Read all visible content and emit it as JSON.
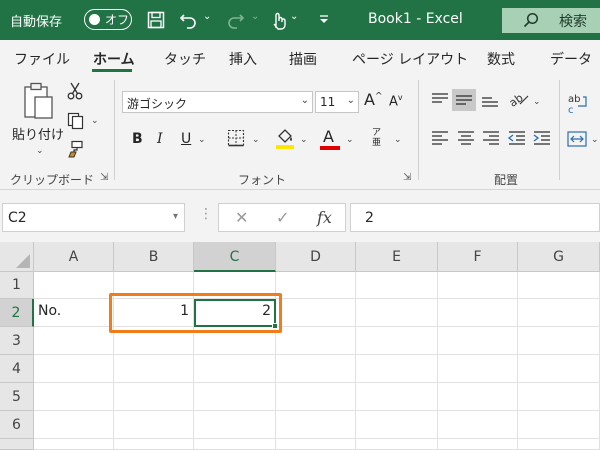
{
  "titlebar": {
    "autosave_label": "自動保存",
    "autosave_state": "オフ",
    "title": "Book1  -  Excel",
    "search_label": "検索"
  },
  "tabs": [
    "ファイル",
    "ホーム",
    "タッチ",
    "挿入",
    "描画",
    "ページ レイアウト",
    "数式",
    "データ"
  ],
  "active_tab": "ホーム",
  "ribbon": {
    "clipboard": {
      "paste_label": "貼り付け",
      "group_label": "クリップボード"
    },
    "font": {
      "font_name": "游ゴシック",
      "font_size": "11",
      "bold": "B",
      "italic": "I",
      "underline": "U",
      "font_color_glyph": "A",
      "group_label": "フォント",
      "highlight_color": "#ffe600",
      "font_color": "#e00000"
    },
    "alignment": {
      "group_label": "配置"
    }
  },
  "formula_bar": {
    "name_box": "C2",
    "fx": "fx",
    "formula": "2"
  },
  "grid": {
    "columns": [
      "A",
      "B",
      "C",
      "D",
      "E",
      "F",
      "G"
    ],
    "selected_column": "C",
    "rows": [
      "1",
      "2",
      "3",
      "4",
      "5",
      "6"
    ],
    "selected_row": "2",
    "cells": {
      "A2": "No.",
      "B2": "1",
      "C2": "2"
    }
  },
  "colors": {
    "brand": "#217346",
    "highlight": "#f07d1a"
  }
}
